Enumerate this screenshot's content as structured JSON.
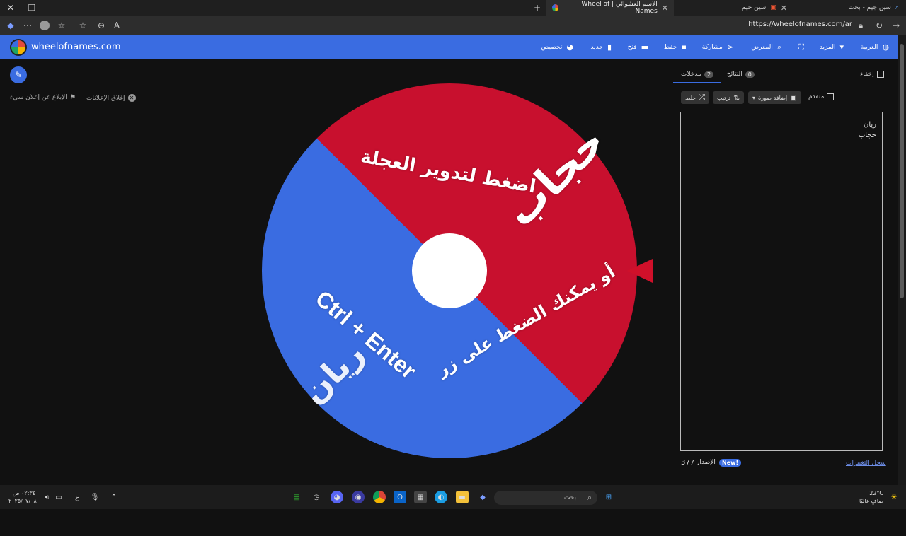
{
  "browser": {
    "tabs": [
      {
        "label": "سين جيم - بحث",
        "active": false
      },
      {
        "label": "سين جيم",
        "active": false
      },
      {
        "label": "الاسم العشوائي | Wheel of Names",
        "active": true
      }
    ],
    "url": "https://wheelofnames.com/ar"
  },
  "site": {
    "logo_text": "wheelofnames.com",
    "menu": [
      {
        "label": "العربية",
        "icon": "globe-icon"
      },
      {
        "label": "المزيد",
        "icon": "caret-down-icon"
      },
      {
        "label": "",
        "icon": "fullscreen-icon"
      },
      {
        "label": "المعرض",
        "icon": "search-icon"
      },
      {
        "label": "مشاركة",
        "icon": "share-icon"
      },
      {
        "label": "حفظ",
        "icon": "save-icon"
      },
      {
        "label": "فتح",
        "icon": "folder-icon"
      },
      {
        "label": "جديد",
        "icon": "new-file-icon"
      },
      {
        "label": "تخصيص",
        "icon": "palette-icon"
      }
    ]
  },
  "ads": {
    "close_ads": "إغلاق الإعلانات",
    "report_ad": "الإبلاغ عن إعلان سيء"
  },
  "wheel": {
    "top_text": "اضغط لتدوير العجلة",
    "bottom_text": "أو يمكنك الضغط على زر",
    "shortcut": "Ctrl + Enter",
    "slice_red_label": "حجاب",
    "slice_blue_label": "ريان",
    "colors": {
      "red": "#c8102e",
      "blue": "#3a6ce1"
    }
  },
  "panel": {
    "hide_label": "إخفاء",
    "results_label": "النتائج",
    "results_count": "0",
    "entries_label": "مدخلات",
    "entries_count": "2",
    "shuffle_label": "خلط",
    "sort_label": "ترتيب",
    "add_image_label": "إضافة صورة",
    "advanced_label": "متقدم",
    "entries": [
      "ريان",
      "حجاب"
    ],
    "version_label": "الإصدار",
    "version_number": "377",
    "new_badge": "New!",
    "changelog_label": "سجل التغييرات"
  },
  "taskbar": {
    "search_placeholder": "بحث",
    "clock_time": "٠٢:٣٤ ص",
    "clock_date": "٢٠٢٥/٠٧/٠٨",
    "weather_temp": "22°C",
    "weather_desc": "صافٍ غالبًا",
    "lang": "ع"
  }
}
